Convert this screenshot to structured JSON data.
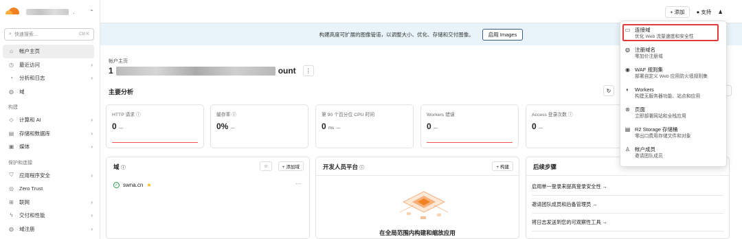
{
  "sidebar": {
    "search_placeholder": "快速搜索...",
    "search_shortcut": "Ctrl K",
    "items_top": [
      {
        "label": "帐户主页",
        "icon": "home-icon",
        "active": true
      },
      {
        "label": "最近访问",
        "icon": "clock-icon",
        "chev": true
      },
      {
        "label": "分析和日志",
        "icon": "chart-icon",
        "chev": true
      },
      {
        "label": "域",
        "icon": "globe-icon",
        "chev": false
      }
    ],
    "section_build": "构建",
    "items_build": [
      {
        "label": "计算和 AI",
        "icon": "compute-icon",
        "chev": true
      },
      {
        "label": "存储和数据库",
        "icon": "storage-icon",
        "chev": true
      },
      {
        "label": "媒体",
        "icon": "media-icon",
        "chev": true
      }
    ],
    "section_protect": "保护和连接",
    "items_protect": [
      {
        "label": "应用程序安全",
        "icon": "shield-icon",
        "chev": true
      },
      {
        "label": "Zero Trust",
        "icon": "zerotrust-icon",
        "chev": false
      },
      {
        "label": "联网",
        "icon": "network-icon",
        "chev": true
      },
      {
        "label": "交付和性能",
        "icon": "bolt-icon",
        "chev": true
      },
      {
        "label": "域注册",
        "icon": "globe-icon",
        "chev": true
      }
    ]
  },
  "topbar": {
    "add_label": "+ 添加",
    "support_label": "支持"
  },
  "banner": {
    "text": "构建高度可扩展的图像管道，以调整大小、优化、存储和交付图像。",
    "button": "启用 Images"
  },
  "main": {
    "account_label": "帐户主页",
    "account_name_prefix": "1",
    "account_name_suffix": "ount",
    "analytics_title": "主要分析",
    "metrics": [
      {
        "label": "HTTP 请求",
        "value": "0",
        "unit": "",
        "dash": "—"
      },
      {
        "label": "缓存率",
        "value": "0%",
        "unit": "",
        "dash": "—"
      },
      {
        "label": "第 90 个百分位 CPU 时间",
        "value": "0",
        "unit": "ms",
        "dash": "—"
      },
      {
        "label": "Workers 错误",
        "value": "0",
        "unit": "",
        "dash": "—"
      },
      {
        "label": "Access 登录次数",
        "value": "0",
        "unit": "",
        "dash": "—"
      }
    ],
    "domains_card": {
      "title": "域",
      "add_button": "+ 添加域",
      "domain": "swna.cn"
    },
    "dev_card": {
      "title": "开发人员平台",
      "button": "+ 构建",
      "caption": "在全局范围内构建和缩放应用"
    },
    "next_card": {
      "title": "后续步骤",
      "items": [
        "启用单一登录来提高登录安全性 →",
        "邀请团队成员和后备管理员 →",
        "将日志发送到您的可观察性工具 →"
      ]
    }
  },
  "dropdown": {
    "items": [
      {
        "icon": "window-icon",
        "title": "连接域",
        "subtitle": "优化 Web 流量速度和安全性"
      },
      {
        "icon": "globe-icon",
        "title": "注册域名",
        "subtitle": "零加价注册域"
      },
      {
        "icon": "waf-icon",
        "title": "WAF 规则集",
        "subtitle": "部署自定义 Web 应用防火墙规则集"
      },
      {
        "icon": "workers-icon",
        "title": "Workers",
        "subtitle": "构建无服务器功能、站点和应用"
      },
      {
        "icon": "pages-icon",
        "title": "页面",
        "subtitle": "立即部署网站和全栈应用"
      },
      {
        "icon": "storage-icon",
        "title": "R2 Storage 存储桶",
        "subtitle": "零出口费用存储文件和对象"
      },
      {
        "icon": "user-icon",
        "title": "帐户成员",
        "subtitle": "邀请团队成员"
      }
    ]
  },
  "colors": {
    "brand_orange": "#f48120",
    "highlight_red": "#e03a3a",
    "banner_bg": "#e8f4f9"
  }
}
